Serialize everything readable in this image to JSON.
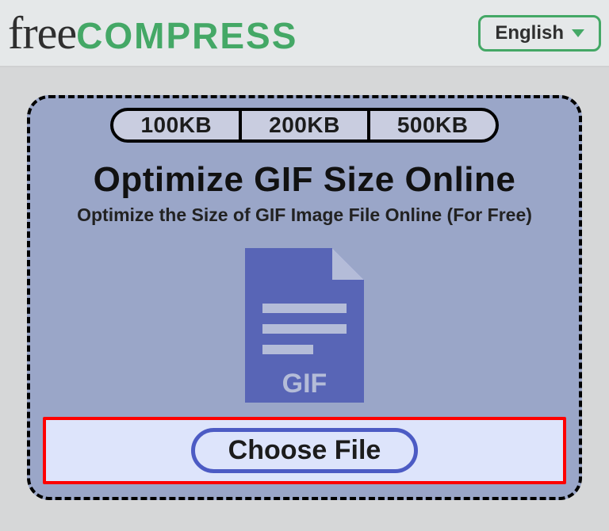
{
  "header": {
    "logo_free": "free",
    "logo_compress": "COMPRESS",
    "lang_label": "English"
  },
  "panel": {
    "sizePresets": [
      "100KB",
      "200KB",
      "500KB"
    ],
    "headline": "Optimize GIF Size Online",
    "subline": "Optimize the Size of GIF Image File Online (For Free)",
    "file_badge": "GIF",
    "choose_label": "Choose File"
  }
}
